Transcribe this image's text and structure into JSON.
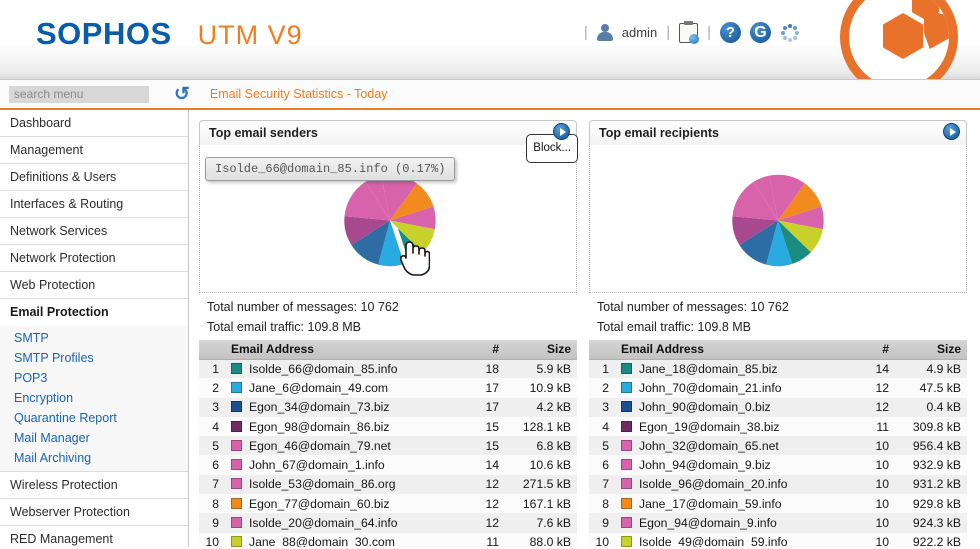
{
  "header": {
    "brand": "SOPHOS",
    "product": "UTM V9",
    "user_label": "admin",
    "separator": "|",
    "help_glyph": "?",
    "reload_glyph": "G",
    "icons": {
      "user": "user-icon",
      "clipboard": "clipboard-search-icon",
      "help": "help-icon",
      "reload": "reload-icon",
      "spinner": "spinner-icon",
      "logo": "sophos-shield-logo"
    }
  },
  "subbar": {
    "search_placeholder": "search menu",
    "search_value": "",
    "reload_icon": "reload-arrow-icon",
    "breadcrumb": "Email Security Statistics - Today"
  },
  "sidebar": {
    "items": [
      {
        "label": "Dashboard",
        "active": false
      },
      {
        "label": "Management",
        "active": false
      },
      {
        "label": "Definitions & Users",
        "active": false
      },
      {
        "label": "Interfaces & Routing",
        "active": false
      },
      {
        "label": "Network Services",
        "active": false
      },
      {
        "label": "Network Protection",
        "active": false
      },
      {
        "label": "Web Protection",
        "active": false
      },
      {
        "label": "Email Protection",
        "active": true
      },
      {
        "label": "Wireless Protection",
        "active": false
      },
      {
        "label": "Webserver Protection",
        "active": false
      },
      {
        "label": "RED Management",
        "active": false
      }
    ],
    "sub_items": [
      {
        "label": "SMTP"
      },
      {
        "label": "SMTP Profiles"
      },
      {
        "label": "POP3"
      },
      {
        "label": "Encryption"
      },
      {
        "label": "Quarantine Report"
      },
      {
        "label": "Mail Manager"
      },
      {
        "label": "Mail Archiving"
      }
    ]
  },
  "panels": [
    {
      "title": "Top email senders",
      "arrow_icon": "expand-arrow-icon",
      "block_tooltip": "Block...",
      "pie_tooltip": "Isolde_66@domain_85.info (0.17%)",
      "total_messages": "Total number of messages: 10 762",
      "total_traffic": "Total email traffic: 109.8 MB",
      "columns": {
        "rank": "",
        "address": "Email Address",
        "count": "#",
        "size": "Size"
      },
      "rows": [
        {
          "rank": "1",
          "color": "#1b8c82",
          "address": "Isolde_66@domain_85.info",
          "count": "18",
          "size": "5.9 kB"
        },
        {
          "rank": "2",
          "color": "#29abe2",
          "address": "Jane_6@domain_49.com",
          "count": "17",
          "size": "10.9 kB"
        },
        {
          "rank": "3",
          "color": "#1b4f91",
          "address": "Egon_34@domain_73.biz",
          "count": "17",
          "size": "4.2 kB"
        },
        {
          "rank": "4",
          "color": "#6b2d62",
          "address": "Egon_98@domain_86.biz",
          "count": "15",
          "size": "128.1 kB"
        },
        {
          "rank": "5",
          "color": "#d963ab",
          "address": "Egon_46@domain_79.net",
          "count": "15",
          "size": "6.8 kB"
        },
        {
          "rank": "6",
          "color": "#d963ab",
          "address": "John_67@domain_1.info",
          "count": "14",
          "size": "10.6 kB"
        },
        {
          "rank": "7",
          "color": "#d963ab",
          "address": "Isolde_53@domain_86.org",
          "count": "12",
          "size": "271.5 kB"
        },
        {
          "rank": "8",
          "color": "#f18b1f",
          "address": "Egon_77@domain_60.biz",
          "count": "12",
          "size": "167.1 kB"
        },
        {
          "rank": "9",
          "color": "#d963ab",
          "address": "Isolde_20@domain_64.info",
          "count": "12",
          "size": "7.6 kB"
        },
        {
          "rank": "10",
          "color": "#c8d129",
          "address": "Jane_88@domain_30.com",
          "count": "11",
          "size": "88.0 kB"
        }
      ]
    },
    {
      "title": "Top email recipients",
      "arrow_icon": "expand-arrow-icon",
      "block_tooltip": "",
      "pie_tooltip": "",
      "total_messages": "Total number of messages: 10 762",
      "total_traffic": "Total email traffic: 109.8 MB",
      "columns": {
        "rank": "",
        "address": "Email Address",
        "count": "#",
        "size": "Size"
      },
      "rows": [
        {
          "rank": "1",
          "color": "#1b8c82",
          "address": "Jane_18@domain_85.biz",
          "count": "14",
          "size": "4.9 kB"
        },
        {
          "rank": "2",
          "color": "#29abe2",
          "address": "John_70@domain_21.info",
          "count": "12",
          "size": "47.5 kB"
        },
        {
          "rank": "3",
          "color": "#1b4f91",
          "address": "John_90@domain_0.biz",
          "count": "12",
          "size": "0.4 kB"
        },
        {
          "rank": "4",
          "color": "#6b2d62",
          "address": "Egon_19@domain_38.biz",
          "count": "11",
          "size": "309.8 kB"
        },
        {
          "rank": "5",
          "color": "#d963ab",
          "address": "John_32@domain_65.net",
          "count": "10",
          "size": "956.4 kB"
        },
        {
          "rank": "6",
          "color": "#d963ab",
          "address": "John_94@domain_9.biz",
          "count": "10",
          "size": "932.9 kB"
        },
        {
          "rank": "7",
          "color": "#d963ab",
          "address": "Isolde_96@domain_20.info",
          "count": "10",
          "size": "931.2 kB"
        },
        {
          "rank": "8",
          "color": "#f18b1f",
          "address": "Jane_17@domain_59.info",
          "count": "10",
          "size": "929.8 kB"
        },
        {
          "rank": "9",
          "color": "#d963ab",
          "address": "Egon_94@domain_9.info",
          "count": "10",
          "size": "924.3 kB"
        },
        {
          "rank": "10",
          "color": "#c8d129",
          "address": "Isolde_49@domain_59.info",
          "count": "10",
          "size": "922.2 kB"
        }
      ]
    }
  ],
  "chart_data": [
    {
      "type": "pie",
      "title": "Top email senders",
      "labels": [
        "Isolde_66@domain_85.info",
        "Jane_6@domain_49.com",
        "Egon_34@domain_73.biz",
        "Egon_98@domain_86.biz",
        "Egon_46@domain_79.net",
        "John_67@domain_1.info",
        "Isolde_53@domain_86.org",
        "Egon_77@domain_60.biz",
        "Isolde_20@domain_64.info",
        "Jane_88@domain_30.com"
      ],
      "values": [
        18,
        17,
        17,
        15,
        15,
        14,
        12,
        12,
        12,
        11
      ],
      "colors": [
        "#1b8c82",
        "#29abe2",
        "#1b4f91",
        "#6b2d62",
        "#d963ab",
        "#d963ab",
        "#d963ab",
        "#f18b1f",
        "#d963ab",
        "#c8d129"
      ],
      "exploded_index": 0,
      "legend": "table",
      "highlight_percent": "0.17%"
    },
    {
      "type": "pie",
      "title": "Top email recipients",
      "labels": [
        "Jane_18@domain_85.biz",
        "John_70@domain_21.info",
        "John_90@domain_0.biz",
        "Egon_19@domain_38.biz",
        "John_32@domain_65.net",
        "John_94@domain_9.biz",
        "Isolde_96@domain_20.info",
        "Jane_17@domain_59.info",
        "Egon_94@domain_9.info",
        "Isolde_49@domain_59.info"
      ],
      "values": [
        14,
        12,
        12,
        11,
        10,
        10,
        10,
        10,
        10,
        10
      ],
      "colors": [
        "#1b8c82",
        "#29abe2",
        "#1b4f91",
        "#6b2d62",
        "#d963ab",
        "#d963ab",
        "#d963ab",
        "#f18b1f",
        "#d963ab",
        "#c8d129"
      ],
      "exploded_index": -1,
      "legend": "table"
    }
  ],
  "colors": {
    "brand_blue": "#0a5ca8",
    "accent_orange": "#ef7d22",
    "link_blue": "#1c63b0"
  }
}
